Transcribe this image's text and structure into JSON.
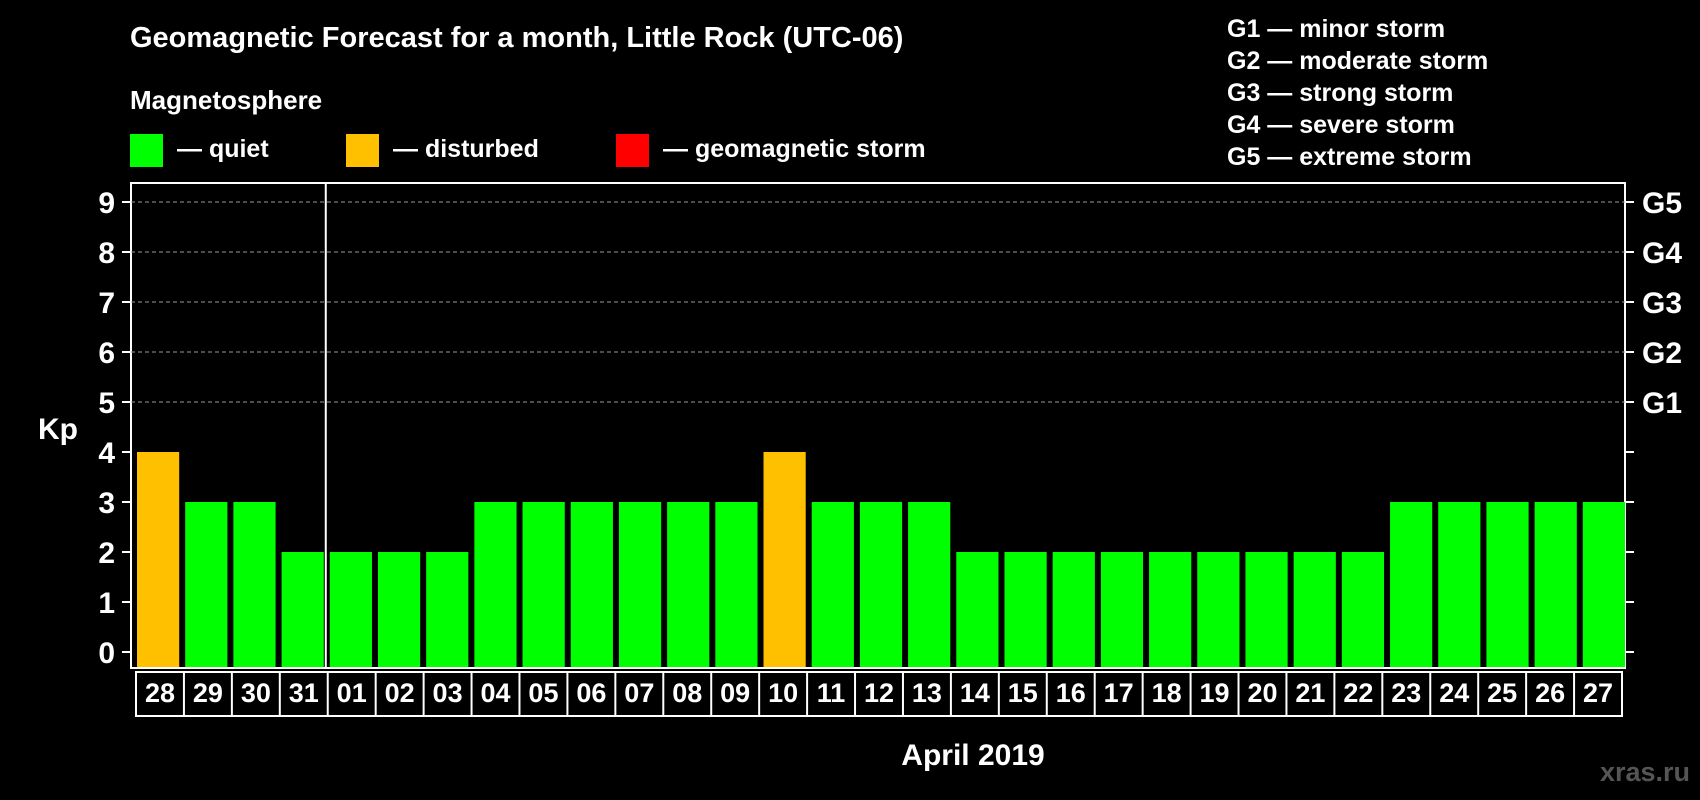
{
  "title": "Geomagnetic Forecast for a month, Little Rock (UTC-06)",
  "magnetosphere_label": "Magnetosphere",
  "legend": [
    {
      "label": "— quiet",
      "color": "#00ff00"
    },
    {
      "label": "— disturbed",
      "color": "#ffc000"
    },
    {
      "label": "— geomagnetic storm",
      "color": "#ff0000"
    }
  ],
  "storm_scale": [
    "G1 — minor storm",
    "G2 — moderate storm",
    "G3 — strong storm",
    "G4 — severe storm",
    "G5 — extreme storm"
  ],
  "watermark": "xras.ru",
  "chart_data": {
    "type": "bar",
    "ylabel": "Kp",
    "xlabel": "April 2019",
    "ylim": [
      0,
      9
    ],
    "yticks": [
      0,
      1,
      2,
      3,
      4,
      5,
      6,
      7,
      8,
      9
    ],
    "right_axis_labels": [
      {
        "kp": 5,
        "label": "G1"
      },
      {
        "kp": 6,
        "label": "G2"
      },
      {
        "kp": 7,
        "label": "G3"
      },
      {
        "kp": 8,
        "label": "G4"
      },
      {
        "kp": 9,
        "label": "G5"
      }
    ],
    "month_boundary_after": "31",
    "grid": "dashed lines at Kp 5-9",
    "categories": [
      "28",
      "29",
      "30",
      "31",
      "01",
      "02",
      "03",
      "04",
      "05",
      "06",
      "07",
      "08",
      "09",
      "10",
      "11",
      "12",
      "13",
      "14",
      "15",
      "16",
      "17",
      "18",
      "19",
      "20",
      "21",
      "22",
      "23",
      "24",
      "25",
      "26",
      "27"
    ],
    "values": [
      4,
      3,
      3,
      2,
      2,
      2,
      2,
      3,
      3,
      3,
      3,
      3,
      3,
      4,
      3,
      3,
      3,
      2,
      2,
      2,
      2,
      2,
      2,
      2,
      2,
      2,
      3,
      3,
      3,
      3,
      3
    ],
    "status": [
      "disturbed",
      "quiet",
      "quiet",
      "quiet",
      "quiet",
      "quiet",
      "quiet",
      "quiet",
      "quiet",
      "quiet",
      "quiet",
      "quiet",
      "quiet",
      "disturbed",
      "quiet",
      "quiet",
      "quiet",
      "quiet",
      "quiet",
      "quiet",
      "quiet",
      "quiet",
      "quiet",
      "quiet",
      "quiet",
      "quiet",
      "quiet",
      "quiet",
      "quiet",
      "quiet",
      "quiet"
    ],
    "colors": {
      "quiet": "#00ff00",
      "disturbed": "#ffc000",
      "storm": "#ff0000"
    }
  }
}
